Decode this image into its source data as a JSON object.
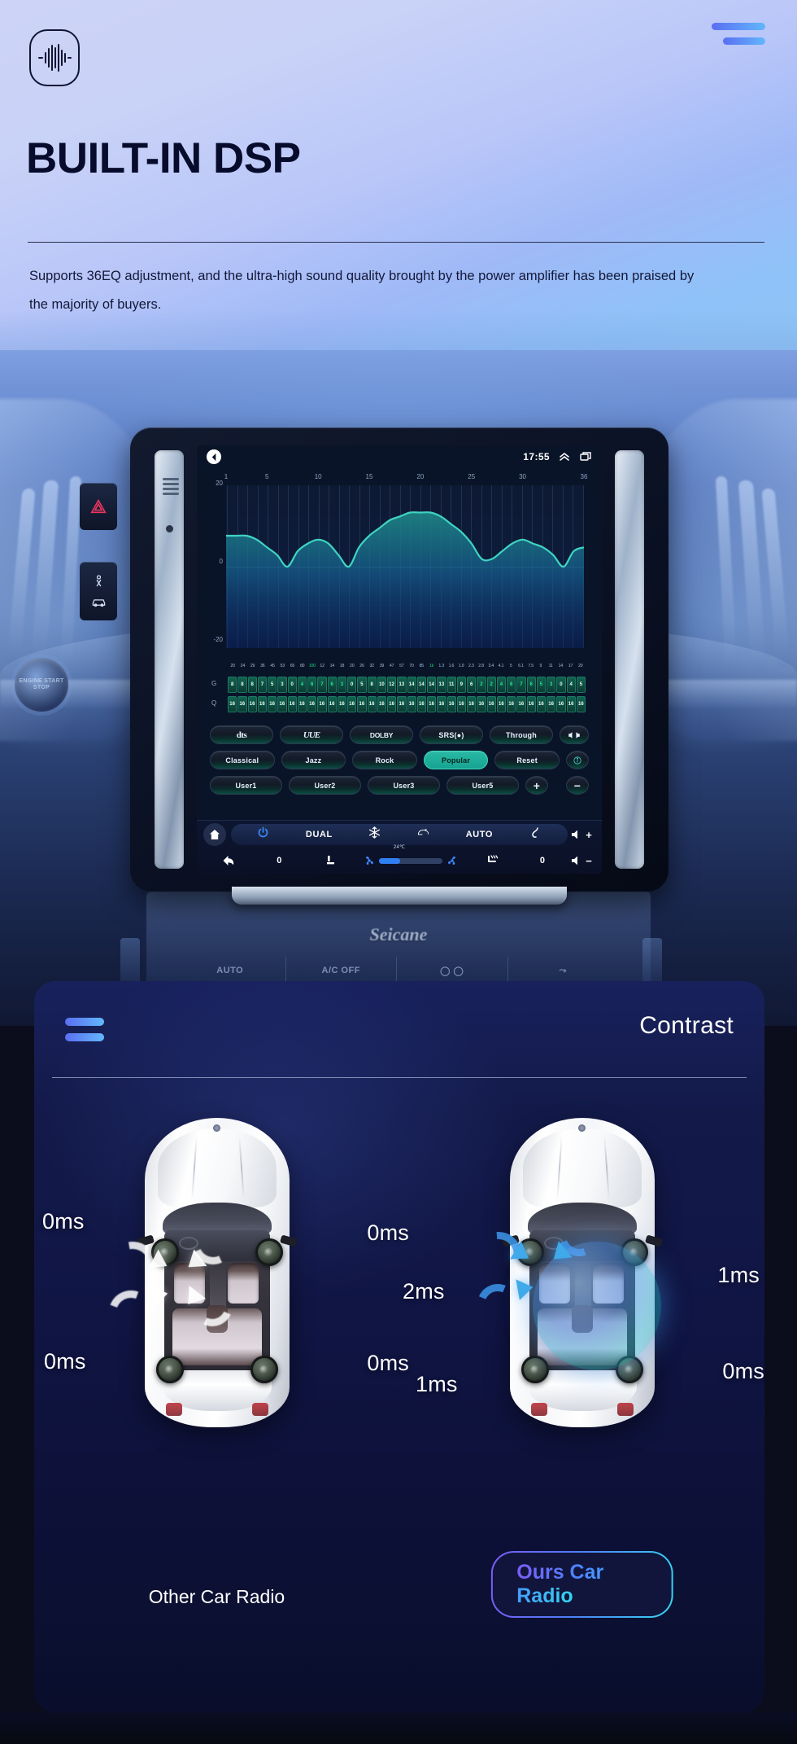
{
  "hero": {
    "logo_icon": "sound-wave-icon",
    "menu_icon": "hamburger-menu-icon",
    "title": "BUILT-IN DSP",
    "description": "Supports 36EQ adjustment, and the ultra-high sound quality brought by the power amplifier has been praised by the majority of buyers."
  },
  "dashboard": {
    "brand": "Seicane",
    "start_button": "ENGINE START STOP",
    "climate_keys": [
      "AUTO",
      "A/C OFF",
      "◯ ◯",
      "⤳"
    ]
  },
  "head_unit": {
    "status": {
      "back_icon": "back-triangle-icon",
      "time": "17:55",
      "chevron_icon": "chevron-up-icon",
      "recents_icon": "recent-apps-icon"
    },
    "eq_chart": {
      "x_ticks": [
        "1",
        "5",
        "10",
        "15",
        "20",
        "25",
        "30",
        "36"
      ],
      "y_ticks": [
        "20",
        "0",
        "-20"
      ]
    },
    "gq": {
      "row_labels": [
        "G",
        "Q"
      ],
      "frequencies": [
        "20",
        "24",
        "29",
        "36",
        "45",
        "53",
        "65",
        "80",
        "100",
        "12",
        "14",
        "18",
        "20",
        "26",
        "32",
        "39",
        "47",
        "57",
        "70",
        "85",
        "1k",
        "1.3",
        "1.6",
        "1.9",
        "2.3",
        "2.8",
        "3.4",
        "4.1",
        "5",
        "6.1",
        "7.5",
        "9",
        "11",
        "14",
        "17",
        "20"
      ],
      "highlight_freq_indexes": [
        8,
        20
      ],
      "gain": [
        "8",
        "8",
        "8",
        "7",
        "5",
        "3",
        "0",
        "4",
        "6",
        "7",
        "6",
        "3",
        "0",
        "5",
        "8",
        "10",
        "12",
        "13",
        "14",
        "14",
        "14",
        "13",
        "11",
        "9",
        "6",
        "2",
        "2",
        "4",
        "6",
        "7",
        "6",
        "5",
        "3",
        "0",
        "4",
        "5"
      ],
      "q": [
        "16",
        "16",
        "16",
        "16",
        "16",
        "16",
        "16",
        "16",
        "16",
        "16",
        "16",
        "16",
        "16",
        "16",
        "16",
        "16",
        "16",
        "16",
        "16",
        "16",
        "16",
        "16",
        "16",
        "16",
        "16",
        "16",
        "16",
        "16",
        "16",
        "16",
        "16",
        "16",
        "16",
        "16",
        "16",
        "16"
      ]
    },
    "presets": {
      "row1": [
        "dts",
        "UUE",
        "DOLBY",
        "SRS(●)",
        "Through",
        "speaker-balance-icon"
      ],
      "row2": [
        "Classical",
        "Jazz",
        "Rock",
        "Popular",
        "Reset",
        "info-icon"
      ],
      "row3": [
        "User1",
        "User2",
        "User3",
        "User5",
        "+",
        "−"
      ],
      "active": "Popular"
    },
    "climate": {
      "home_icon": "home-icon",
      "power_icon": "power-icon",
      "dual_label": "DUAL",
      "snowflake_icon": "snowflake-icon",
      "recirculate_icon": "air-recirculation-icon",
      "auto_label": "AUTO",
      "defrost_icon": "windshield-defrost-icon",
      "volume_up_icon": "volume-up-icon",
      "temperature": "24℃",
      "back_icon": "back-arrow-icon",
      "left_value": "0",
      "seat_icon": "seat-icon",
      "fan_left_icon": "fan-icon",
      "fan_right_icon": "fan-icon",
      "fan_level_percent": 33,
      "seat_heat_icon": "seat-heat-icon",
      "right_value": "0",
      "volume_down_icon": "volume-down-icon"
    }
  },
  "contrast": {
    "menu_icon": "hamburger-menu-icon",
    "title": "Contrast",
    "left_car": {
      "caption": "Other Car Radio",
      "delays": {
        "front_left": "0ms",
        "front_right": "0ms",
        "rear_left": "0ms",
        "rear_right": "0ms"
      },
      "arrow_color": "#ffffff"
    },
    "right_car": {
      "caption": "Ours Car Radio",
      "delays": {
        "front_left": "2ms",
        "front_right": "1ms",
        "rear_left": "1ms",
        "rear_right": "0ms"
      },
      "arrow_color": "#3fa9ea",
      "highlighted": true
    }
  },
  "colors": {
    "accent_blue": "#5a6ef2",
    "accent_cyan": "#35d7f0",
    "hero_text": "#080c2c",
    "panel_bg": "#11153c",
    "eq_line": "#3fd4c2",
    "active_preset": "#29b9a4"
  }
}
